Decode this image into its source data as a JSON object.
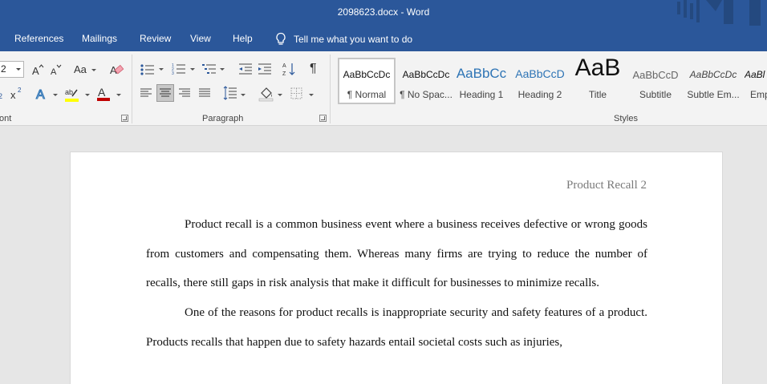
{
  "window": {
    "title": "2098623.docx  -  Word"
  },
  "menu": {
    "tabs": [
      "References",
      "Mailings",
      "Review",
      "View",
      "Help"
    ],
    "tell_me": "Tell me what you want to do"
  },
  "ribbon": {
    "font": {
      "group_label": "ont",
      "size_value": "2",
      "change_case_label": "Aa"
    },
    "paragraph": {
      "group_label": "Paragraph"
    },
    "styles": {
      "group_label": "Styles",
      "items": [
        {
          "sample": "AaBbCcDc",
          "name": "¶ Normal"
        },
        {
          "sample": "AaBbCcDc",
          "name": "¶ No Spac..."
        },
        {
          "sample": "AaBbCc",
          "name": "Heading 1"
        },
        {
          "sample": "AaBbCcD",
          "name": "Heading 2"
        },
        {
          "sample": "AaB",
          "name": "Title"
        },
        {
          "sample": "AaBbCcD",
          "name": "Subtitle"
        },
        {
          "sample": "AaBbCcDc",
          "name": "Subtle Em..."
        },
        {
          "sample": "AaBl",
          "name": "Emp"
        }
      ]
    }
  },
  "document": {
    "header": "Product Recall 2",
    "paragraphs": [
      "Product recall is a common business event where a business receives defective or wrong goods from customers and compensating them.  Whereas many firms are trying to reduce the number of recalls, there still gaps in risk analysis that make it difficult for businesses to minimize recalls.",
      "One of the reasons for product recalls is inappropriate security and safety features of a product. Products recalls that happen due to safety hazards entail societal costs such as injuries,"
    ]
  },
  "colors": {
    "title_bar": "#2b579a",
    "ribbon_bg": "#f3f3f3",
    "canvas_bg": "#e6e6e6",
    "highlight_yellow": "#ffff00",
    "font_color_red": "#c00000",
    "heading_blue": "#2e74b5"
  }
}
